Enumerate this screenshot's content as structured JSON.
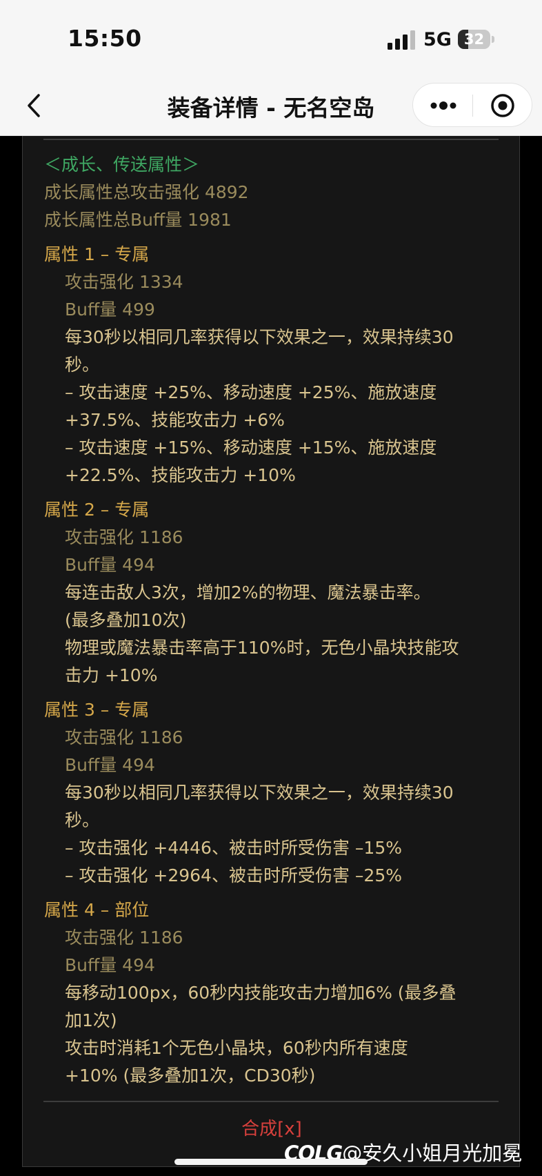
{
  "status_bar": {
    "time": "15:50",
    "network": "5G",
    "battery": 32
  },
  "nav": {
    "title": "装备详情 - 无名空岛"
  },
  "growth": {
    "header": "＜成长、传送属性＞",
    "total_attack": "成长属性总攻击强化 4892",
    "total_buff": "成长属性总Buff量 1981"
  },
  "attributes": [
    {
      "title": "属性 1 – 专属",
      "attack": "攻击强化  1334",
      "buff": "Buff量  499",
      "lines": [
        "每30秒以相同几率获得以下效果之一，效果持续30",
        "秒。",
        "– 攻击速度 +25%、移动速度 +25%、施放速度",
        "+37.5%、技能攻击力 +6%",
        "– 攻击速度 +15%、移动速度 +15%、施放速度",
        "+22.5%、技能攻击力 +10%"
      ]
    },
    {
      "title": "属性 2 – 专属",
      "attack": "攻击强化  1186",
      "buff": "Buff量  494",
      "lines": [
        "每连击敌人3次，增加2%的物理、魔法暴击率。",
        "(最多叠加10次)",
        "物理或魔法暴击率高于110%时，无色小晶块技能攻",
        "击力 +10%"
      ]
    },
    {
      "title": "属性 3 – 专属",
      "attack": "攻击强化  1186",
      "buff": "Buff量  494",
      "lines": [
        "每30秒以相同几率获得以下效果之一，效果持续30",
        "秒。",
        "– 攻击强化 +4446、被击时所受伤害 –15%",
        "– 攻击强化 +2964、被击时所受伤害 –25%"
      ]
    },
    {
      "title": "属性 4 – 部位",
      "attack": "攻击强化  1186",
      "buff": "Buff量  494",
      "lines": [
        "每移动100px，60秒内技能攻击力增加6% (最多叠",
        "加1次)",
        "攻击时消耗1个无色小晶块，60秒内所有速度",
        "+10% (最多叠加1次，CD30秒)"
      ]
    }
  ],
  "synth_label": "合成[x]",
  "watermark": {
    "logo": "COLG",
    "text": "@安久小姐月光加冕"
  },
  "icons": {
    "back": "chevron-left-icon",
    "more": "more-dots-icon",
    "close": "target-close-icon",
    "signal": "cellular-signal-icon",
    "battery": "battery-icon"
  },
  "colors": {
    "panel_bg": "#161616",
    "green_header": "#3fa863",
    "attr_title": "#d6a84a",
    "muted_stat": "#9a8b5c",
    "body_text": "#d9c48f",
    "synth": "#d8403c"
  }
}
